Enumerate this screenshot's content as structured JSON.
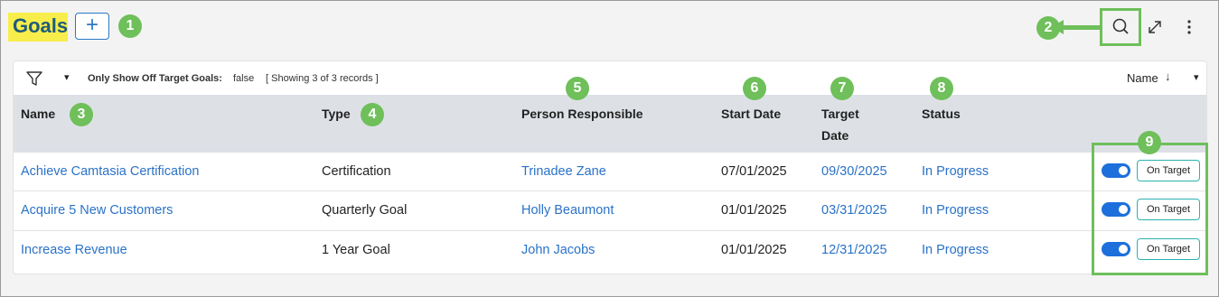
{
  "header": {
    "title": "Goals",
    "add_label": "+",
    "search_icon": "search-icon",
    "expand_icon": "expand-icon",
    "more_icon": "more-vertical-icon"
  },
  "callouts": [
    "1",
    "2",
    "3",
    "4",
    "5",
    "6",
    "7",
    "8",
    "9"
  ],
  "filterbar": {
    "filter_icon": "filter-icon",
    "filter_caret": "▾",
    "off_target_label": "Only Show Off Target Goals:",
    "off_target_value": "false",
    "showing": "[ Showing 3 of 3 records ]",
    "sort_label": "Name",
    "sort_icon": "↓",
    "sort_caret": "▾"
  },
  "table": {
    "columns": {
      "name": "Name",
      "type": "Type",
      "person": "Person Responsible",
      "start": "Start Date",
      "target_line1": "Target",
      "target_line2": "Date",
      "status": "Status"
    },
    "rows": [
      {
        "name": "Achieve Camtasia Certification",
        "type": "Certification",
        "person": "Trinadee Zane",
        "start": "07/01/2025",
        "target": "09/30/2025",
        "status": "In Progress",
        "action": "On Target"
      },
      {
        "name": "Acquire 5 New Customers",
        "type": "Quarterly Goal",
        "person": "Holly Beaumont",
        "start": "01/01/2025",
        "target": "03/31/2025",
        "status": "In Progress",
        "action": "On Target"
      },
      {
        "name": "Increase Revenue",
        "type": "1 Year Goal",
        "person": "John Jacobs",
        "start": "01/01/2025",
        "target": "12/31/2025",
        "status": "In Progress",
        "action": "On Target"
      }
    ]
  },
  "colors": {
    "accent": "#2a72c7",
    "callout": "#6fbf5a",
    "title_highlight": "#f7ee4b",
    "toggle": "#1d6fdc"
  }
}
